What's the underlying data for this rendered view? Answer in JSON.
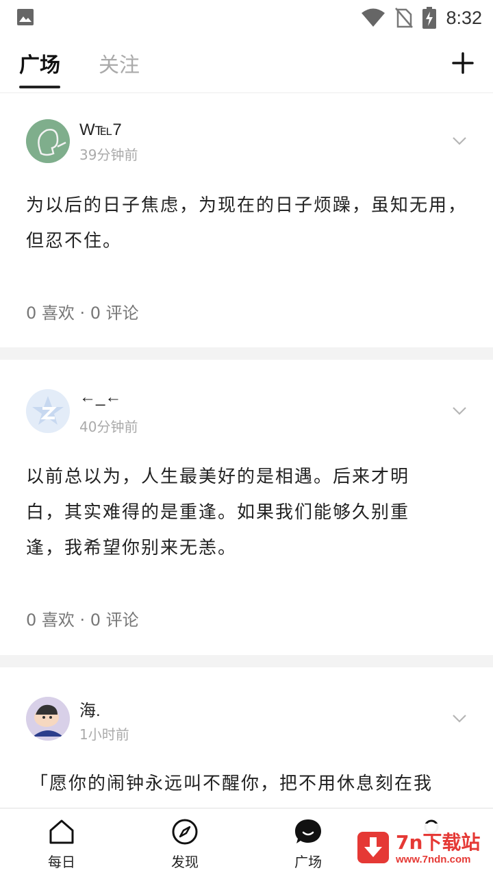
{
  "status_bar": {
    "time": "8:32"
  },
  "header": {
    "tabs": [
      {
        "label": "广场",
        "active": true
      },
      {
        "label": "关注",
        "active": false
      }
    ]
  },
  "posts": [
    {
      "username": "W℡7",
      "time_ago": "39分钟前",
      "content": "为以后的日子焦虑，为现在的日子烦躁，虽知无用，但忍不住。",
      "stats": "0 喜欢 · 0 评论"
    },
    {
      "username": "←_←",
      "time_ago": "40分钟前",
      "content": "以前总以为，人生最美好的是相遇。后来才明白，其实难得的是重逢。如果我们能够久别重逢，我希望你别来无恙。",
      "stats": "0 喜欢 · 0 评论"
    },
    {
      "username": "海.",
      "time_ago": "1小时前",
      "content": "「愿你的闹钟永远叫不醒你，把不用休息刻在我",
      "stats": ""
    }
  ],
  "bottom_nav": [
    {
      "label": "每日",
      "icon": "home-icon"
    },
    {
      "label": "发现",
      "icon": "compass-icon"
    },
    {
      "label": "广场",
      "icon": "chat-bubble-icon",
      "active": true
    },
    {
      "label": "",
      "icon": "profile-icon"
    }
  ],
  "watermark": {
    "title": "7n下载站",
    "url": "www.7ndn.com"
  },
  "colors": {
    "accent": "#222222",
    "muted": "#aaaaaa",
    "divider": "#f3f3f3",
    "watermark_red": "#e53935"
  }
}
